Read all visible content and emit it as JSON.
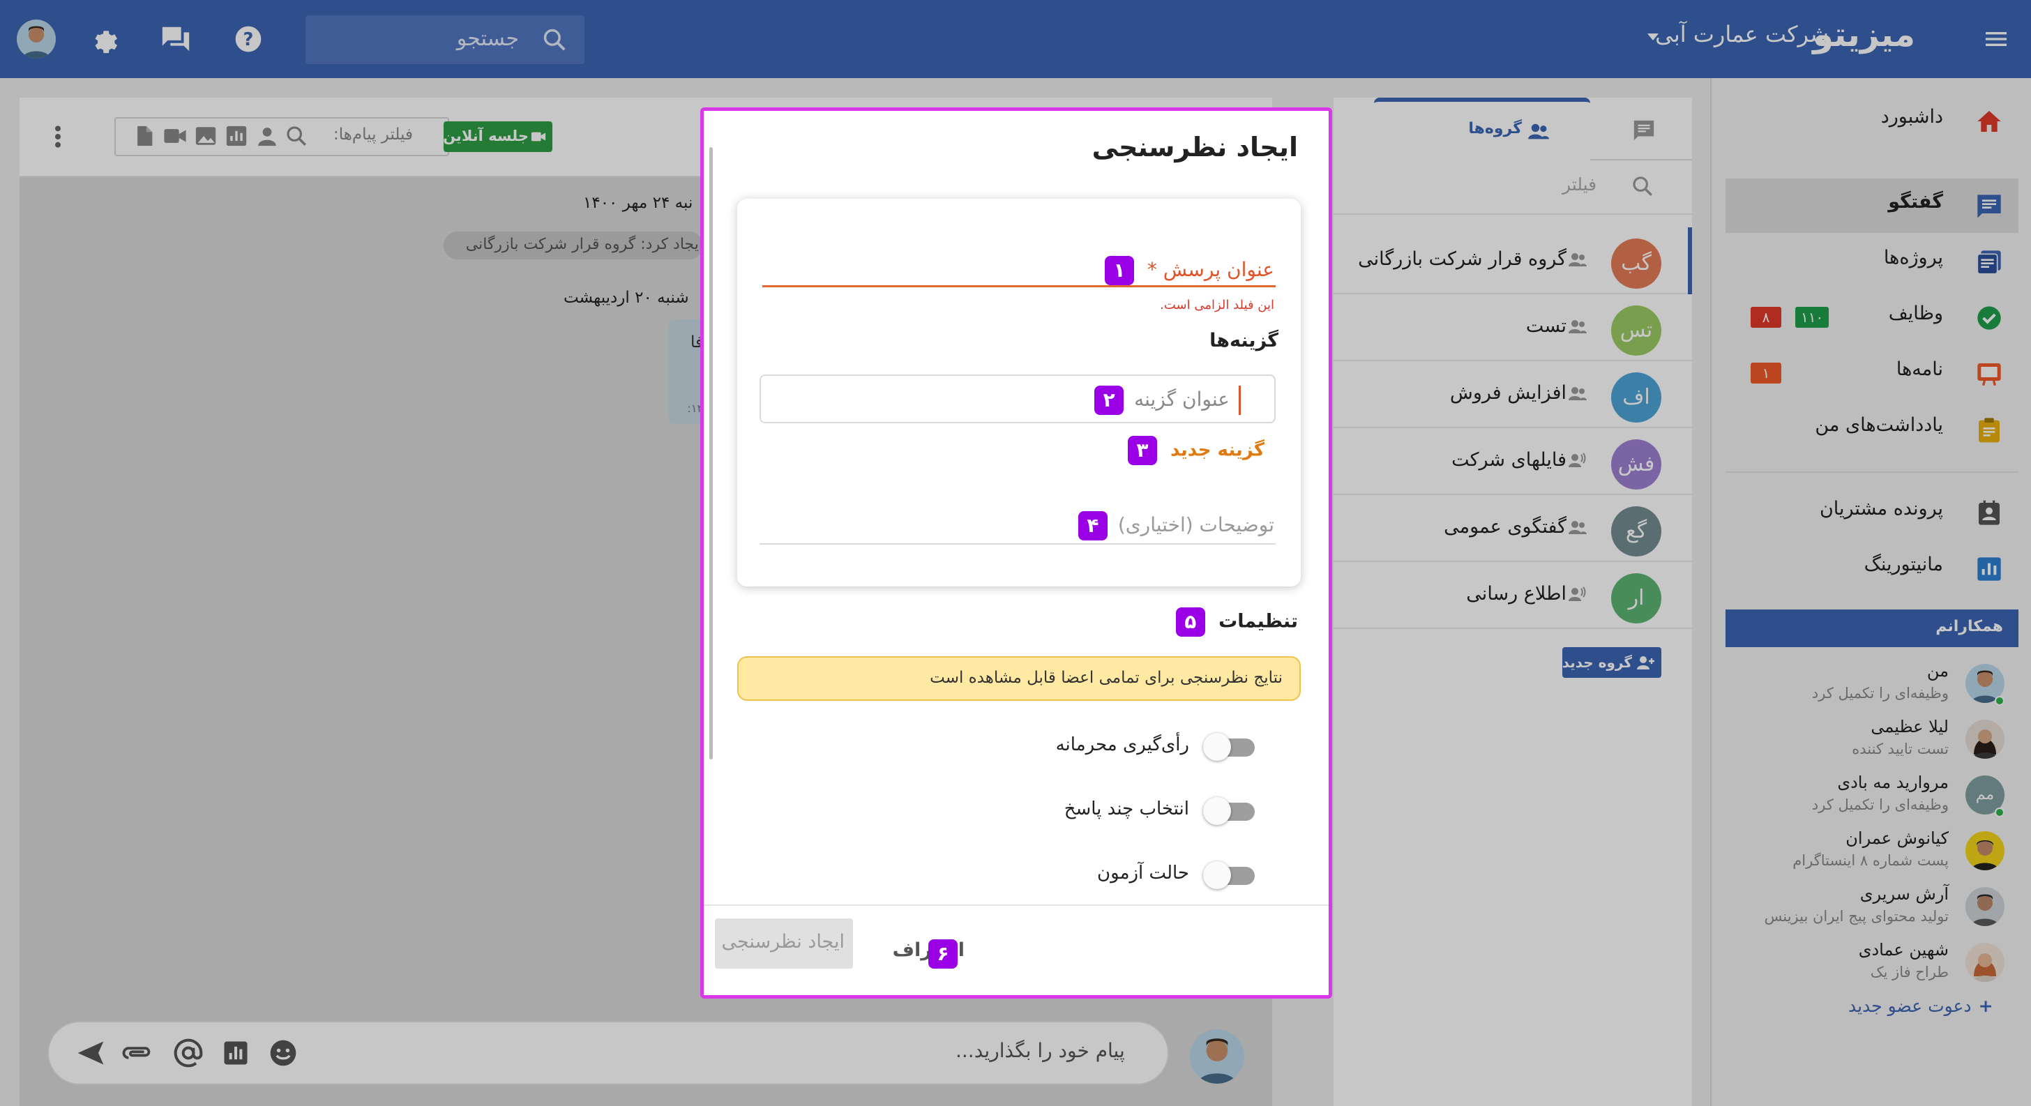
{
  "header": {
    "brand": "میزیتو",
    "company": "شرکت عمارت آبی",
    "search_placeholder": "جستجو"
  },
  "sidebar": {
    "items": [
      {
        "label": "داشبورد"
      },
      {
        "label": "گفتگو"
      },
      {
        "label": "پروژه‌ها"
      },
      {
        "label": "وظایف",
        "badges": [
          "۱۱۰",
          "۸"
        ]
      },
      {
        "label": "نامه‌ها",
        "badges": [
          "۱"
        ]
      },
      {
        "label": "یادداشت‌های من"
      },
      {
        "label": "پرونده مشتریان"
      },
      {
        "label": "مانیتورینگ"
      }
    ],
    "colleagues_title": "همکارانم",
    "colleagues": [
      {
        "name": "من",
        "status": "وظیفه‌ای را تکمیل کرد"
      },
      {
        "name": "لیلا عظیمی",
        "status": "تست تایید کننده"
      },
      {
        "name": "مروارید مه بادی",
        "status": "وظیفه‌ای را تکمیل کرد",
        "initials": "مم"
      },
      {
        "name": "کیانوش عمران",
        "status": "پست شماره ۸ اینستاگرام"
      },
      {
        "name": "آرش سریری",
        "status": "تولید محتوای پیج ایران بیزینس"
      },
      {
        "name": "شهین عمادی",
        "status": "طراح فاز یک"
      }
    ],
    "invite": "دعوت عضو جدید"
  },
  "groups": {
    "tab_label": "گروه‌ها",
    "filter_placeholder": "فیلتر",
    "items": [
      {
        "name": "گروه قرار شرکت بازرگانی",
        "initials": "گب",
        "color": "#e0643a"
      },
      {
        "name": "تست",
        "initials": "تس",
        "color": "#8bc34a"
      },
      {
        "name": "افزایش فروش",
        "initials": "اف",
        "color": "#2f95d2"
      },
      {
        "name": "فایلهای شرکت",
        "initials": "فش",
        "color": "#8e6cc9"
      },
      {
        "name": "گفتگوی عمومی",
        "initials": "گع",
        "color": "#5c7a7e"
      },
      {
        "name": "اطلاع رسانی",
        "initials": "ار",
        "color": "#3fa85a"
      }
    ],
    "new_group": "گروه جدید"
  },
  "chat": {
    "filter_placeholder": "فیلتر پیام‌ها:",
    "live_session": "جلسه آنلاین",
    "date1": "نبه ۲۴ مهر ۱۴۰۰",
    "created_by": "ایجاد کرد: گروه قرار شرکت بازرگانی",
    "date2": "شنبه ۲۰ اردیبهشت",
    "bubble_text": "فا",
    "bubble_time": "۱۴:",
    "composer_placeholder": "پیام خود را بگذارید..."
  },
  "modal": {
    "title": "ایجاد نظرسنجی",
    "question_label": "عنوان پرسش *",
    "question_error": "این فیلد الزامی است.",
    "options_label": "گزینه‌ها",
    "option_placeholder": "عنوان گزینه",
    "new_option": "گزینه جدید",
    "description_placeholder": "توضیحات (اختیاری)",
    "settings_label": "تنظیمات",
    "info": "نتایج نظرسنجی برای تمامی اعضا قابل مشاهده است",
    "toggles": [
      {
        "label": "رأی‌گیری محرمانه",
        "on": false
      },
      {
        "label": "انتخاب چند پاسخ",
        "on": false
      },
      {
        "label": "حالت آزمون",
        "on": false
      }
    ],
    "create_button": "ایجاد نظرسنجی",
    "cancel_button": "انصراف",
    "markers": [
      "۱",
      "۲",
      "۳",
      "۴",
      "۵",
      "۶"
    ]
  },
  "colors": {
    "primary": "#3c64b4",
    "marker": "#9a00e6",
    "modal_border": "#d838e8",
    "error": "#e0542a"
  }
}
